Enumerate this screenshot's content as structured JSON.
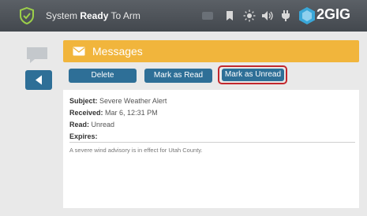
{
  "topbar": {
    "status_prefix": "System ",
    "status_strong": "Ready",
    "status_suffix": " To Arm",
    "brand": "2GIG",
    "icons": [
      "shield-check-icon",
      "bookmark-icon",
      "brightness-icon",
      "volume-icon",
      "power-plug-icon",
      "brand-logo-icon"
    ]
  },
  "sidebar": {
    "icons": [
      "chat-bubble-icon",
      "back-arrow-icon"
    ]
  },
  "header": {
    "title": "Messages",
    "icon": "mail-icon"
  },
  "actions": {
    "delete_label": "Delete",
    "mark_read_label": "Mark as Read",
    "mark_unread_label": "Mark as Unread"
  },
  "message": {
    "subject_label": "Subject:",
    "subject": "Severe Weather Alert",
    "received_label": "Received:",
    "received": "Mar 6, 12:31 PM",
    "read_label": "Read:",
    "read": "Unread",
    "expires_label": "Expires:",
    "expires": "",
    "body": "A severe wind advisory is in effect for Utah County."
  },
  "colors": {
    "topbar": "#4f5459",
    "accent_blue": "#2e6f97",
    "header_orange": "#f1b53c",
    "highlight_red": "#c2272d",
    "shield_green": "#9ccf4a",
    "brand_cyan": "#3aa7d8"
  }
}
